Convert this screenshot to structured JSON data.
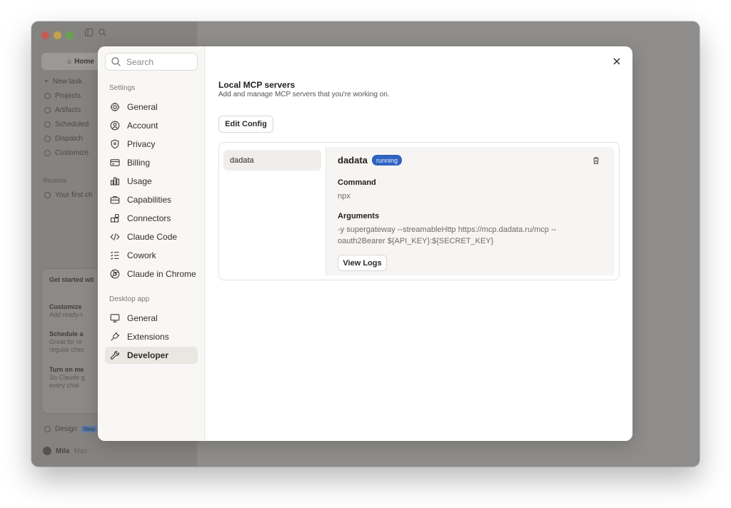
{
  "background": {
    "home_label": "Home",
    "nav_items": [
      "New task",
      "Projects",
      "Artifacts",
      "Scheduled",
      "Dispatch",
      "Customize"
    ],
    "recents_label": "Recents",
    "recent_item": "Your first ch",
    "card": {
      "title": "Get started wit",
      "items": [
        {
          "title": "Customize",
          "sub1": "Add ready-t",
          "sub2": ""
        },
        {
          "title": "Schedule a",
          "sub1": "Great for re",
          "sub2": "regular chec"
        },
        {
          "title": "Turn on me",
          "sub1": "So Claude g",
          "sub2": "every chat"
        }
      ]
    },
    "design_label": "Design",
    "design_badge": "New",
    "user_name": "Mila",
    "user_plan": "Max"
  },
  "sidebar": {
    "search_placeholder": "Search",
    "settings_label": "Settings",
    "settings_items": [
      "General",
      "Account",
      "Privacy",
      "Billing",
      "Usage",
      "Capabilities",
      "Connectors",
      "Claude Code",
      "Cowork",
      "Claude in Chrome"
    ],
    "desktop_label": "Desktop app",
    "desktop_items": [
      "General",
      "Extensions",
      "Developer"
    ],
    "active_item": "Developer"
  },
  "main": {
    "title": "Local MCP servers",
    "subtitle": "Add and manage MCP servers that you're working on.",
    "edit_config_label": "Edit Config",
    "servers": [
      "dadata"
    ],
    "detail": {
      "name": "dadata",
      "status": "running",
      "command_label": "Command",
      "command_value": "npx",
      "arguments_label": "Arguments",
      "arguments_value": "-y supergateway --streamableHttp https://mcp.dadata.ru/mcp --oauth2Bearer ${API_KEY}:${SECRET_KEY}",
      "view_logs_label": "View Logs"
    }
  },
  "colors": {
    "status_badge": "#2f64c1",
    "traffic_red": "#e5584f",
    "traffic_yellow": "#e3b33c",
    "traffic_green": "#5fbe45"
  }
}
